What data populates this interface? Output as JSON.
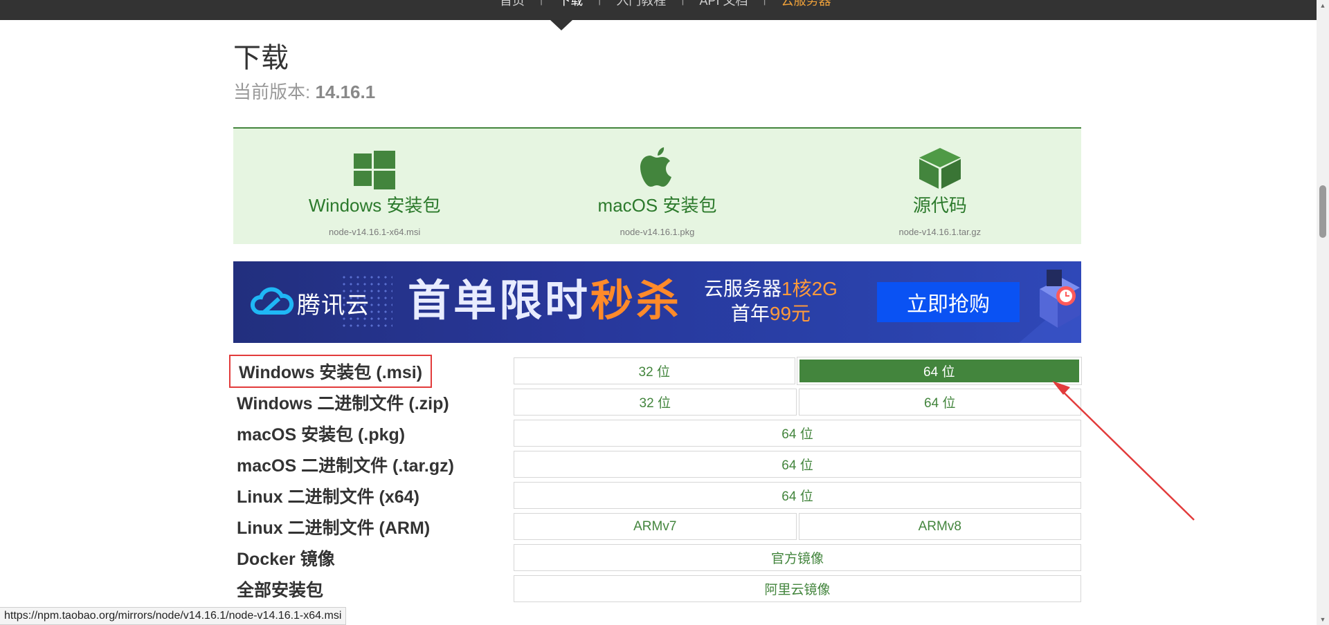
{
  "nav": {
    "items": [
      {
        "label": "首页",
        "state": "normal"
      },
      {
        "label": "下载",
        "state": "active"
      },
      {
        "label": "入门教程",
        "state": "normal"
      },
      {
        "label": "API 文档",
        "state": "normal"
      },
      {
        "label": "云服务器",
        "state": "highlight"
      }
    ]
  },
  "page": {
    "title": "下载",
    "version_label": "当前版本: ",
    "version": "14.16.1"
  },
  "quick_downloads": [
    {
      "icon": "windows-icon",
      "label": "Windows 安装包",
      "file": "node-v14.16.1-x64.msi"
    },
    {
      "icon": "apple-icon",
      "label": "macOS 安装包",
      "file": "node-v14.16.1.pkg"
    },
    {
      "icon": "source-box-icon",
      "label": "源代码",
      "file": "node-v14.16.1.tar.gz"
    }
  ],
  "banner": {
    "brand": "腾讯云",
    "promo_main": "首单限时",
    "promo_hot": "秒杀",
    "offer_line1_prefix": "云服务器",
    "offer_line1_highlight": "1核2G",
    "offer_line2_prefix": "首年",
    "offer_line2_highlight": "99元",
    "button": "立即抢购"
  },
  "table": {
    "rows": [
      {
        "label": "Windows 安装包 (.msi)",
        "links": [
          "32 位",
          "64 位"
        ]
      },
      {
        "label": "Windows 二进制文件 (.zip)",
        "links": [
          "32 位",
          "64 位"
        ]
      },
      {
        "label": "macOS 安装包 (.pkg)",
        "links": [
          "64 位"
        ]
      },
      {
        "label": "macOS 二进制文件 (.tar.gz)",
        "links": [
          "64 位"
        ]
      },
      {
        "label": "Linux 二进制文件 (x64)",
        "links": [
          "64 位"
        ]
      },
      {
        "label": "Linux 二进制文件 (ARM)",
        "links": [
          "ARMv7",
          "ARMv8"
        ]
      },
      {
        "label": "Docker 镜像",
        "links": [
          "官方镜像"
        ]
      },
      {
        "label": "全部安装包",
        "links": [
          "阿里云镜像"
        ]
      }
    ]
  },
  "status_url": "https://npm.taobao.org/mirrors/node/v14.16.1/node-v14.16.1-x64.msi",
  "colors": {
    "brand_green": "#43853d",
    "panel_bg": "#e6f5e1",
    "annotation_red": "#e23b3b",
    "nav_bg": "#333333"
  }
}
